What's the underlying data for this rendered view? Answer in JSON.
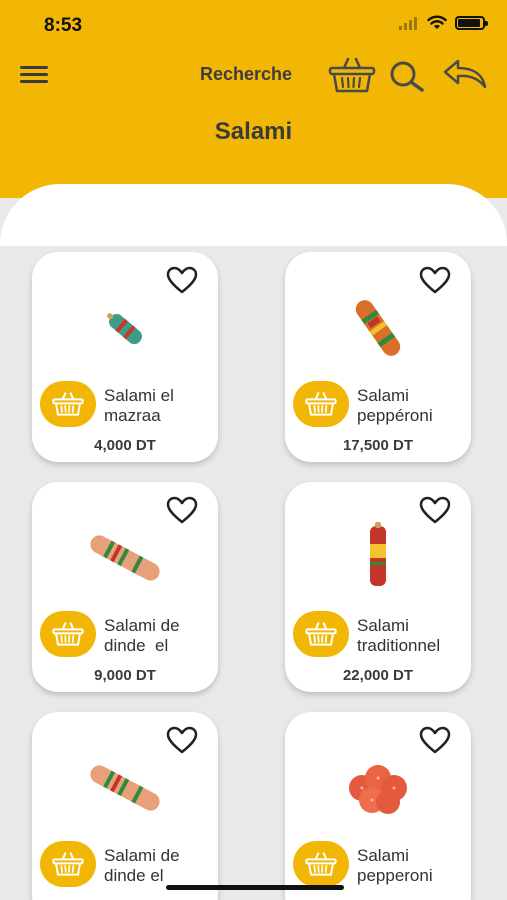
{
  "status_bar": {
    "time": "8:53"
  },
  "app_bar": {
    "search_label": "Recherche"
  },
  "page": {
    "title": "Salami"
  },
  "currency_note": "DT",
  "products": [
    {
      "name": "Salami el mazraa",
      "price": "4,000 DT"
    },
    {
      "name": "Salami peppéroni",
      "price": "17,500 DT"
    },
    {
      "name": "Salami de dinde  el",
      "price": "9,000 DT"
    },
    {
      "name": "Salami traditionnel",
      "price": "22,000 DT"
    },
    {
      "name": "Salami de dinde el",
      "price": ""
    },
    {
      "name": "Salami pepperoni",
      "price": ""
    }
  ],
  "colors": {
    "accent": "#f2b705",
    "background": "#e9e9e9",
    "card": "#ffffff"
  }
}
